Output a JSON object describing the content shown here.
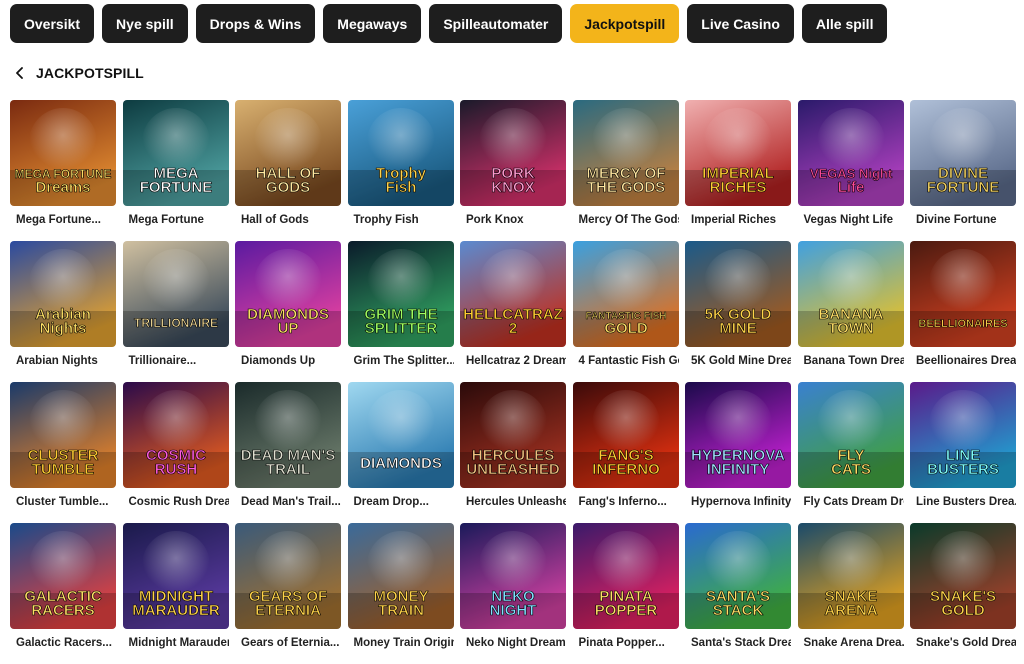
{
  "tabs": [
    {
      "label": "Oversikt",
      "active": false
    },
    {
      "label": "Nye spill",
      "active": false
    },
    {
      "label": "Drops & Wins",
      "active": false
    },
    {
      "label": "Megaways",
      "active": false
    },
    {
      "label": "Spilleautomater",
      "active": false
    },
    {
      "label": "Jackpotspill",
      "active": true
    },
    {
      "label": "Live Casino",
      "active": false
    },
    {
      "label": "Alle spill",
      "active": false
    }
  ],
  "section": {
    "title": "JACKPOTSPILL",
    "back_icon": "chevron-left-icon"
  },
  "colors": {
    "tab_bg": "#1e1e1e",
    "tab_active_bg": "#f3b41a"
  },
  "games": [
    {
      "name": "Mega Fortune...",
      "art": "MEGA FORTUNE Dreams",
      "c1": "#7a2a10",
      "c2": "#e08a30",
      "fg": "#ffe066"
    },
    {
      "name": "Mega Fortune",
      "art": "MEGA FORTUNE",
      "c1": "#0d3b40",
      "c2": "#4ea0a0",
      "fg": "#ffffff"
    },
    {
      "name": "Hall of Gods",
      "art": "HALL OF GODS",
      "c1": "#d8b070",
      "c2": "#7a4a20",
      "fg": "#ffe8a0"
    },
    {
      "name": "Trophy Fish",
      "art": "Trophy Fish",
      "c1": "#4aa0d8",
      "c2": "#1a5a80",
      "fg": "#ffd34a"
    },
    {
      "name": "Pork Knox",
      "art": "PORK KNOX",
      "c1": "#1a1a2a",
      "c2": "#d4306a",
      "fg": "#ff9ad0"
    },
    {
      "name": "Mercy Of The Gods",
      "art": "MERCY OF THE GODS",
      "c1": "#2a6a80",
      "c2": "#c08040",
      "fg": "#ffe6a0"
    },
    {
      "name": "Imperial Riches",
      "art": "IMPERIAL RICHES",
      "c1": "#f0b0b0",
      "c2": "#b02020",
      "fg": "#ffcc33"
    },
    {
      "name": "Vegas Night Life",
      "art": "VEGAS Night Life",
      "c1": "#2a1a6a",
      "c2": "#b040c0",
      "fg": "#ff4a9a"
    },
    {
      "name": "Divine Fortune",
      "art": "DIVINE FORTUNE",
      "c1": "#b0c0d8",
      "c2": "#5a6a8a",
      "fg": "#f0d060"
    },
    {
      "name": "Arabian Nights",
      "art": "Arabian Nights",
      "c1": "#2a4aa0",
      "c2": "#e0a030",
      "fg": "#ffe066"
    },
    {
      "name": "Trillionaire...",
      "art": "TRILLIONAIRE",
      "c1": "#d0c0a0",
      "c2": "#3a4a5a",
      "fg": "#ffe6a0"
    },
    {
      "name": "Diamonds Up",
      "art": "DIAMONDS UP",
      "c1": "#5a1aa0",
      "c2": "#e040a0",
      "fg": "#ffe066"
    },
    {
      "name": "Grim The Splitter...",
      "art": "GRIM THE SPLITTER",
      "c1": "#0a1a2a",
      "c2": "#30a060",
      "fg": "#a0ff60"
    },
    {
      "name": "Hellcatraz 2 Dream...",
      "art": "HELLCATRAZ 2",
      "c1": "#5a8ad0",
      "c2": "#c03020",
      "fg": "#ffcc33"
    },
    {
      "name": "4 Fantastic Fish Go...",
      "art": "FANTASTIC FISH GOLD",
      "c1": "#3aa0e0",
      "c2": "#e07020",
      "fg": "#ffe066"
    },
    {
      "name": "5K Gold Mine Drea...",
      "art": "5K GOLD MINE",
      "c1": "#1a5a8a",
      "c2": "#a05a20",
      "fg": "#ffd34a"
    },
    {
      "name": "Banana Town Drea...",
      "art": "BANANA TOWN",
      "c1": "#40a0e0",
      "c2": "#e0c030",
      "fg": "#ffe066"
    },
    {
      "name": "Beellionaires Drea...",
      "art": "BEELLIONAIRES",
      "c1": "#4a1a10",
      "c2": "#d04020",
      "fg": "#ffd34a"
    },
    {
      "name": "Cluster Tumble...",
      "art": "CLUSTER TUMBLE",
      "c1": "#1a3a6a",
      "c2": "#e0802a",
      "fg": "#ffcc33"
    },
    {
      "name": "Cosmic Rush Drea...",
      "art": "COSMIC RUSH",
      "c1": "#2a0a4a",
      "c2": "#e05a20",
      "fg": "#ff5ae0"
    },
    {
      "name": "Dead Man's Trail...",
      "art": "DEAD MAN'S TRAIL",
      "c1": "#1a2a2a",
      "c2": "#6a7a6a",
      "fg": "#e0e0d0"
    },
    {
      "name": "Dream Drop...",
      "art": "DIAMONDS",
      "c1": "#a0d8f0",
      "c2": "#2a7ab0",
      "fg": "#ffffff"
    },
    {
      "name": "Hercules Unleashe...",
      "art": "HERCULES UNLEASHED",
      "c1": "#2a0a0a",
      "c2": "#a03020",
      "fg": "#f0c080"
    },
    {
      "name": "Fang's Inferno...",
      "art": "FANG'S INFERNO",
      "c1": "#3a0a0a",
      "c2": "#e03010",
      "fg": "#ffcc33"
    },
    {
      "name": "Hypernova Infinity...",
      "art": "HYPERNOVA INFINITY",
      "c1": "#1a0a4a",
      "c2": "#c020d0",
      "fg": "#a0e0ff"
    },
    {
      "name": "Fly Cats Dream Drop",
      "art": "FLY CATS",
      "c1": "#3a80d0",
      "c2": "#40a040",
      "fg": "#ffe066"
    },
    {
      "name": "Line Busters Drea...",
      "art": "LINE BUSTERS",
      "c1": "#5a1a8a",
      "c2": "#20a0d0",
      "fg": "#80ffff"
    },
    {
      "name": "Galactic Racers...",
      "art": "GALACTIC RACERS",
      "c1": "#1a4a8a",
      "c2": "#e04040",
      "fg": "#ffe066"
    },
    {
      "name": "Midnight Marauder...",
      "art": "MIDNIGHT MARAUDER",
      "c1": "#1a1a4a",
      "c2": "#5a3aa0",
      "fg": "#ffd34a"
    },
    {
      "name": "Gears of Eternia...",
      "art": "GEARS OF ETERNIA",
      "c1": "#3a5a7a",
      "c2": "#a07030",
      "fg": "#ffd34a"
    },
    {
      "name": "Money Train Origin...",
      "art": "MONEY TRAIN",
      "c1": "#3a6a9a",
      "c2": "#a0602a",
      "fg": "#ffd34a"
    },
    {
      "name": "Neko Night Dream...",
      "art": "NEKO NIGHT",
      "c1": "#1a1a5a",
      "c2": "#d040a0",
      "fg": "#80e0ff"
    },
    {
      "name": "Pinata Popper...",
      "art": "PINATA POPPER",
      "c1": "#3a1a6a",
      "c2": "#e02060",
      "fg": "#ffe066"
    },
    {
      "name": "Santa's Stack Drea...",
      "art": "SANTA'S STACK",
      "c1": "#2a6ad0",
      "c2": "#40b040",
      "fg": "#ffe066"
    },
    {
      "name": "Snake Arena Drea...",
      "art": "SNAKE ARENA",
      "c1": "#1a4a6a",
      "c2": "#e0a020",
      "fg": "#ffd34a"
    },
    {
      "name": "Snake's Gold Drea...",
      "art": "SNAKE'S GOLD",
      "c1": "#0a3a2a",
      "c2": "#a0402a",
      "fg": "#ffd34a"
    }
  ]
}
